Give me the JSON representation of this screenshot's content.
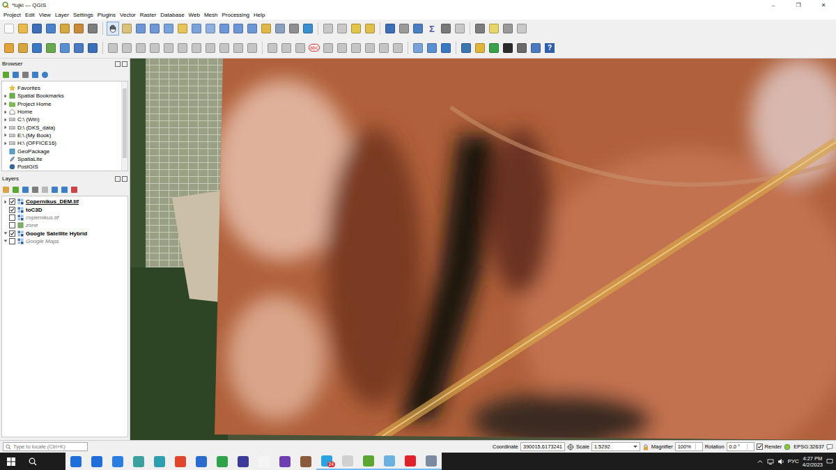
{
  "window": {
    "title": "*lujki — QGIS",
    "controls": [
      "–",
      "❐",
      "✕"
    ]
  },
  "menu": [
    "Project",
    "Edit",
    "View",
    "Layer",
    "Settings",
    "Plugins",
    "Vector",
    "Raster",
    "Database",
    "Web",
    "Mesh",
    "Processing",
    "Help"
  ],
  "toolbar_glyphs": {
    "sum": "Σ",
    "label": "abc",
    "help": "?"
  },
  "pan_tool": {
    "selected": true
  },
  "browser": {
    "title": "Browser",
    "items": [
      {
        "label": "Favorites",
        "kind": "star",
        "expandable": false
      },
      {
        "label": "Spatial Bookmarks",
        "kind": "bookmark",
        "expandable": true
      },
      {
        "label": "Project Home",
        "kind": "project",
        "expandable": true
      },
      {
        "label": "Home",
        "kind": "home",
        "expandable": true
      },
      {
        "label": "C:\\ (Win)",
        "kind": "drive",
        "expandable": true
      },
      {
        "label": "D:\\ (DKS_data)",
        "kind": "drive",
        "expandable": true
      },
      {
        "label": "E:\\ (My Book)",
        "kind": "drive",
        "expandable": true
      },
      {
        "label": "H:\\ (OFFICE16)",
        "kind": "drive",
        "expandable": true
      },
      {
        "label": "GeoPackage",
        "kind": "geopackage",
        "expandable": false
      },
      {
        "label": "SpatiaLite",
        "kind": "spatialite",
        "expandable": false
      },
      {
        "label": "PostGIS",
        "kind": "postgis",
        "expandable": false
      }
    ]
  },
  "layers": {
    "title": "Layers",
    "items": [
      {
        "name": "Copernikus_DEM.tif",
        "kind": "raster",
        "checked": true,
        "current": true,
        "expandable": true,
        "expanded": false
      },
      {
        "name": "toC3D",
        "kind": "raster",
        "checked": true,
        "current": false,
        "expandable": false,
        "expanded": false
      },
      {
        "name": "copernikus.tif",
        "kind": "raster",
        "checked": false,
        "current": false,
        "expandable": false,
        "expanded": false
      },
      {
        "name": "zone",
        "kind": "vector",
        "checked": false,
        "current": false,
        "expandable": false,
        "expanded": false
      },
      {
        "name": "Google Satellite Hybrid",
        "kind": "tile",
        "checked": true,
        "current": false,
        "expandable": true,
        "expanded": true
      },
      {
        "name": "Google Maps",
        "kind": "tile",
        "checked": false,
        "current": false,
        "expandable": true,
        "expanded": true
      }
    ]
  },
  "status_bar": {
    "locate_placeholder": "Type to locate (Ctrl+K)",
    "coordinate_label": "Coordinate",
    "coordinate": "390015,6173241",
    "scale_label": "Scale",
    "scale": "1:5292",
    "magnifier_label": "Magnifier",
    "magnifier": "100%",
    "rotation_label": "Rotation",
    "rotation": "0.0 °",
    "render_label": "Render",
    "render_checked": true,
    "crs": "EPSG:32637"
  },
  "taskbar": {
    "apps": [
      {
        "color": "#1e6fd9",
        "running": false,
        "badge": ""
      },
      {
        "color": "#1e6fd9",
        "running": false,
        "badge": ""
      },
      {
        "color": "#2a7de1",
        "running": false,
        "badge": ""
      },
      {
        "color": "#3aa0a0",
        "running": false,
        "badge": ""
      },
      {
        "color": "#2d9fb0",
        "running": false,
        "badge": ""
      },
      {
        "color": "#e0442a",
        "running": false,
        "badge": ""
      },
      {
        "color": "#2b6bd0",
        "running": false,
        "badge": ""
      },
      {
        "color": "#2ea34a",
        "running": false,
        "badge": ""
      },
      {
        "color": "#3a3a9a",
        "running": false,
        "badge": ""
      },
      {
        "color": "#f5f5f5",
        "running": false,
        "badge": ""
      },
      {
        "color": "#6d3fb0",
        "running": false,
        "badge": ""
      },
      {
        "color": "#8a5a3a",
        "running": false,
        "badge": ""
      },
      {
        "color": "#2aa3e0",
        "running": true,
        "badge": "24"
      },
      {
        "color": "#d0d0d0",
        "running": true,
        "badge": ""
      },
      {
        "color": "#5aa832",
        "running": true,
        "badge": ""
      },
      {
        "color": "#6ab0e0",
        "running": true,
        "badge": ""
      },
      {
        "color": "#e0202a",
        "running": true,
        "badge": ""
      },
      {
        "color": "#7a8aa0",
        "running": true,
        "badge": ""
      }
    ],
    "language": "РУС",
    "time": "4:27 PM",
    "date": "4/2/2023"
  }
}
